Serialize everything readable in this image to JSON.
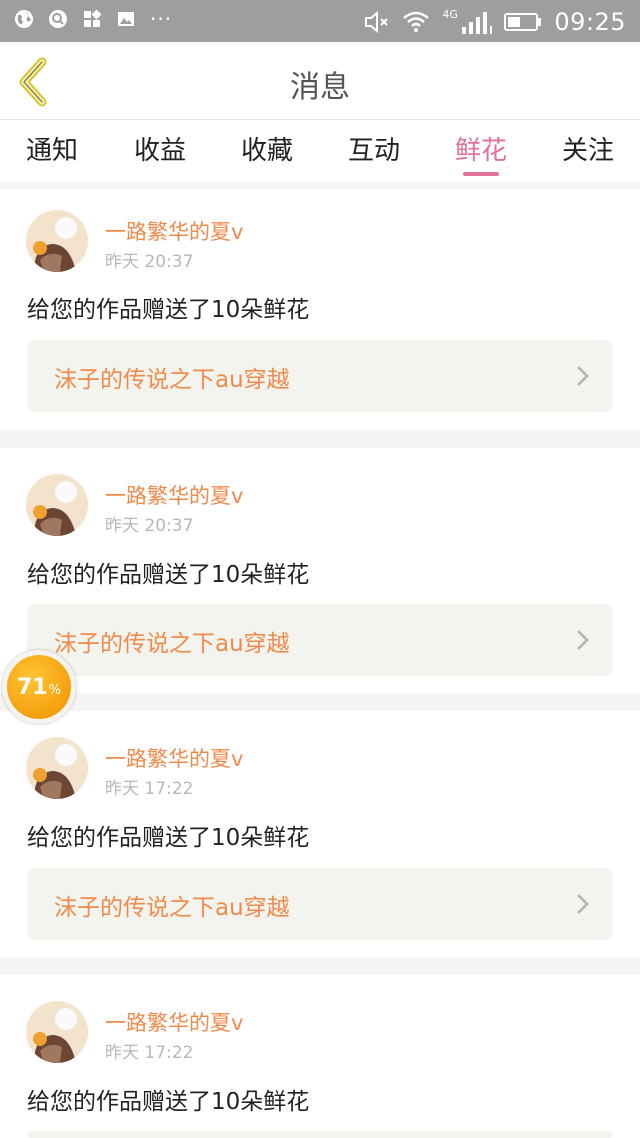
{
  "status_bar": {
    "time": "09:25",
    "network": "4G",
    "left_icons": [
      "globe-icon",
      "search-bubble-icon",
      "apps-icon",
      "image-icon"
    ],
    "overflow": "···"
  },
  "header": {
    "title": "消息",
    "back_icon": "back-chevron-icon"
  },
  "tabs": [
    {
      "label": "通知"
    },
    {
      "label": "收益"
    },
    {
      "label": "收藏"
    },
    {
      "label": "互动"
    },
    {
      "label": "鲜花",
      "active": true
    },
    {
      "label": "关注"
    }
  ],
  "messages": [
    {
      "user": "一路繁华的夏v",
      "time": "昨天 20:37",
      "text": "给您的作品赠送了10朵鲜花",
      "work": "沫子的传说之下au穿越"
    },
    {
      "user": "一路繁华的夏v",
      "time": "昨天 20:37",
      "text": "给您的作品赠送了10朵鲜花",
      "work": "沫子的传说之下au穿越"
    },
    {
      "user": "一路繁华的夏v",
      "time": "昨天 17:22",
      "text": "给您的作品赠送了10朵鲜花",
      "work": "沫子的传说之下au穿越"
    },
    {
      "user": "一路繁华的夏v",
      "time": "昨天 17:22",
      "text": "给您的作品赠送了10朵鲜花",
      "work": ""
    }
  ],
  "progress_badge": {
    "value": "71",
    "unit": "%"
  },
  "colors": {
    "accent_pink": "#e0709a",
    "accent_orange": "#f08a4b",
    "status_bar": "#9e9e9e",
    "badge": "#f5a000"
  }
}
